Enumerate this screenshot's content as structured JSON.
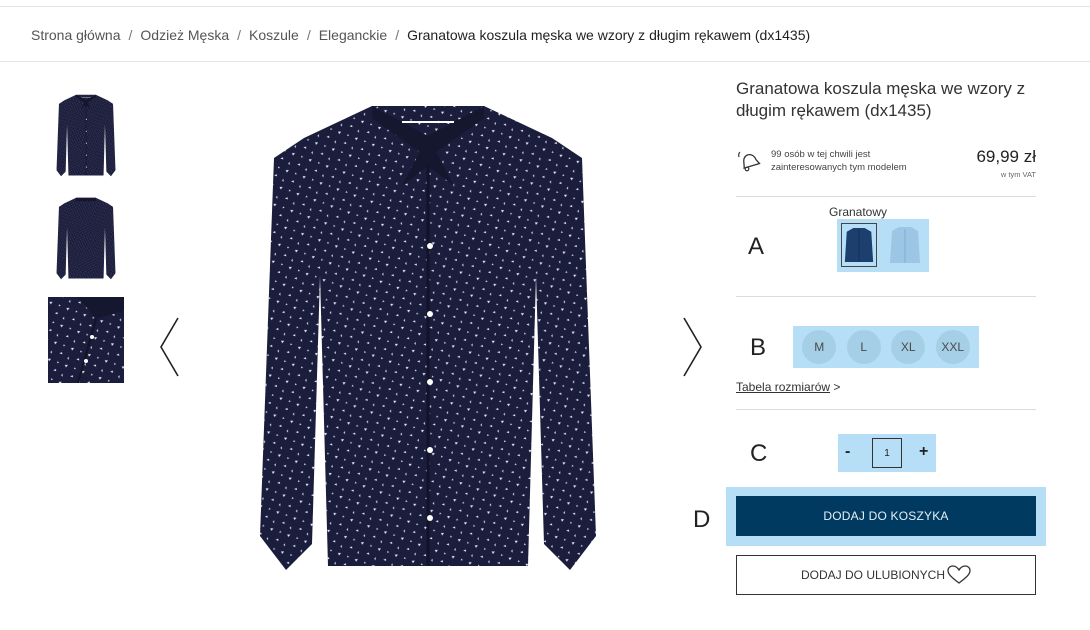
{
  "breadcrumb": {
    "items": [
      "Strona główna",
      "Odzież Męska",
      "Koszule",
      "Eleganckie"
    ],
    "current": "Granatowa koszula męska we wzory z długim rękawem (dx1435)",
    "separator": "/"
  },
  "product": {
    "title": "Granatowa koszula męska we wzory z długim rękawem (dx1435)",
    "interest_text": "99 osób w tej chwili jest zainteresowanych tym modelem",
    "price": "69,99 zł",
    "vat_note": "w tym VAT"
  },
  "color": {
    "selected_name": "Granatowy",
    "options": [
      {
        "name": "navy-shirt-swatch",
        "fill": "#1c3f6e",
        "selected": true
      },
      {
        "name": "light-blue-shirt-swatch",
        "fill": "#9cc6e4",
        "selected": false
      }
    ]
  },
  "sizes": [
    "M",
    "L",
    "XL",
    "XXL"
  ],
  "size_chart": {
    "link_label": "Tabela rozmiarów",
    "chevron": ">"
  },
  "quantity": {
    "minus": "-",
    "value": "1",
    "plus": "+"
  },
  "buttons": {
    "add_to_cart": "DODAJ DO KOSZYKA",
    "add_to_favorites": "DODAJ DO ULUBIONYCH"
  },
  "annotations": {
    "a": "A",
    "b": "B",
    "c": "C",
    "d": "D"
  },
  "colors": {
    "highlight": "#b6dff7",
    "cart_button": "#003a60",
    "shirt": "#1b1d3c"
  },
  "icons": {
    "prev": "chevron-left-icon",
    "next": "chevron-right-icon",
    "interest": "bell-ring-icon",
    "favorite": "heart-icon"
  }
}
